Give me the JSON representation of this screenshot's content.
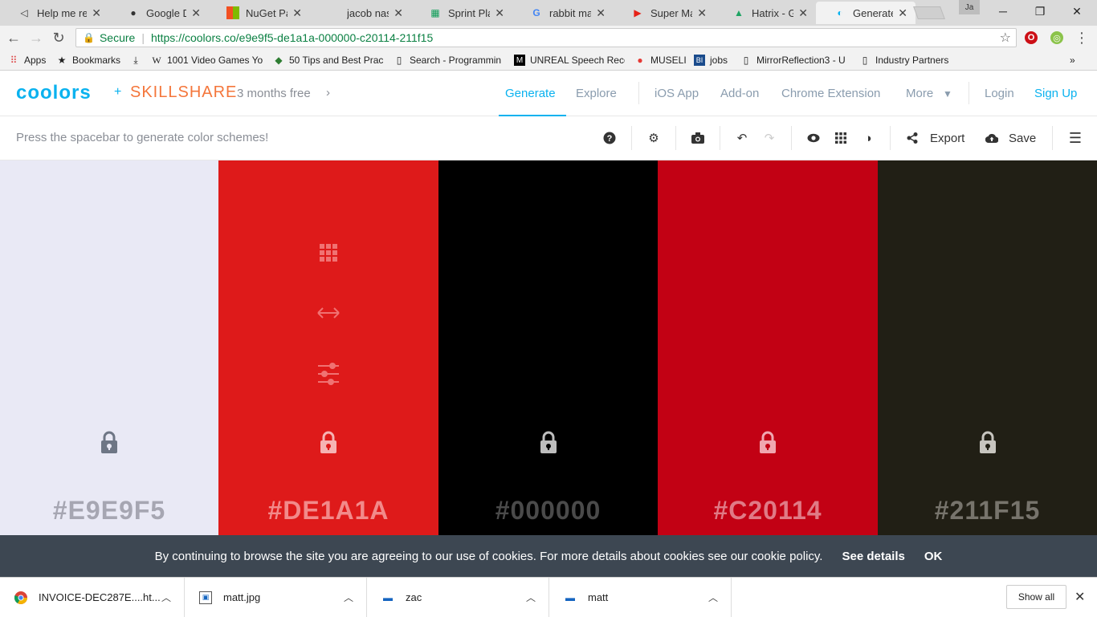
{
  "browser": {
    "tabs": [
      {
        "title": "Help me rea",
        "icon": "unity-icon"
      },
      {
        "title": "Google Driv",
        "icon": "github-icon"
      },
      {
        "title": "NuGet Pack",
        "icon": "microsoft-icon"
      },
      {
        "title": "jacob nash",
        "icon": "blank-icon"
      },
      {
        "title": "Sprint Plan -",
        "icon": "sheets-icon"
      },
      {
        "title": "rabbit mario",
        "icon": "google-icon"
      },
      {
        "title": "Super Mario",
        "icon": "youtube-icon"
      },
      {
        "title": "Hatrix - Goo",
        "icon": "drive-icon"
      },
      {
        "title": "Generate - C",
        "icon": "coolors-icon"
      }
    ],
    "profile_label": "Ja",
    "secure_label": "Secure",
    "url": "https://coolors.co/e9e9f5-de1a1a-000000-c20114-211f15",
    "bookmarks": [
      {
        "label": "Apps",
        "icon": "apps-icon"
      },
      {
        "label": "Bookmarks",
        "icon": "star-icon"
      },
      {
        "label": "",
        "icon": "download-icon"
      },
      {
        "label": "1001 Video Games Yo",
        "icon": "wikipedia-icon"
      },
      {
        "label": "50 Tips and Best Prac",
        "icon": "gem-icon"
      },
      {
        "label": "Search - Programmin",
        "icon": "page-icon"
      },
      {
        "label": "UNREAL Speech Reco",
        "icon": "medium-icon"
      },
      {
        "label": "MUSELI",
        "icon": "museli-icon"
      },
      {
        "label": "jobs",
        "icon": "bi-icon"
      },
      {
        "label": "MirrorReflection3 - U",
        "icon": "page-icon"
      },
      {
        "label": "Industry Partners",
        "icon": "page-icon"
      }
    ],
    "more_bookmarks": "»"
  },
  "site": {
    "logo": "coolors",
    "plus": "+",
    "partner": "SKILLSHARE",
    "promo": "3 months free",
    "nav": [
      "Generate",
      "Explore",
      "iOS App",
      "Add-on",
      "Chrome Extension",
      "More"
    ],
    "login": "Login",
    "signup": "Sign Up",
    "hint": "Press the spacebar to generate color schemes!",
    "export_label": "Export",
    "save_label": "Save"
  },
  "palette": [
    {
      "hex": "#E9E9F5",
      "bg": "#e9e9f5",
      "text_color": "#a6a6b2",
      "lock_color": "#6e7685"
    },
    {
      "hex": "#DE1A1A",
      "bg": "#de1a1a",
      "text_color": "#f28a8a",
      "lock_color": "#f6b3b3"
    },
    {
      "hex": "#000000",
      "bg": "#000000",
      "text_color": "#4a4a4a",
      "lock_color": "#bdbdbd"
    },
    {
      "hex": "#C20114",
      "bg": "#c20114",
      "text_color": "#e07a86",
      "lock_color": "#f0a7b0"
    },
    {
      "hex": "#211F15",
      "bg": "#211f15",
      "text_color": "#77746c",
      "lock_color": "#c7c5bf"
    }
  ],
  "cookie": {
    "message": "By continuing to browse the site you are agreeing to our use of cookies. For more details about cookies see our cookie policy.",
    "details": "See details",
    "ok": "OK"
  },
  "downloads": {
    "items": [
      {
        "name": "INVOICE-DEC287E....ht...",
        "icon": "chrome-icon"
      },
      {
        "name": "matt.jpg",
        "icon": "image-file-icon"
      },
      {
        "name": "zac",
        "icon": "app-file-icon"
      },
      {
        "name": "matt",
        "icon": "app-file-icon"
      }
    ],
    "show_all": "Show all"
  }
}
